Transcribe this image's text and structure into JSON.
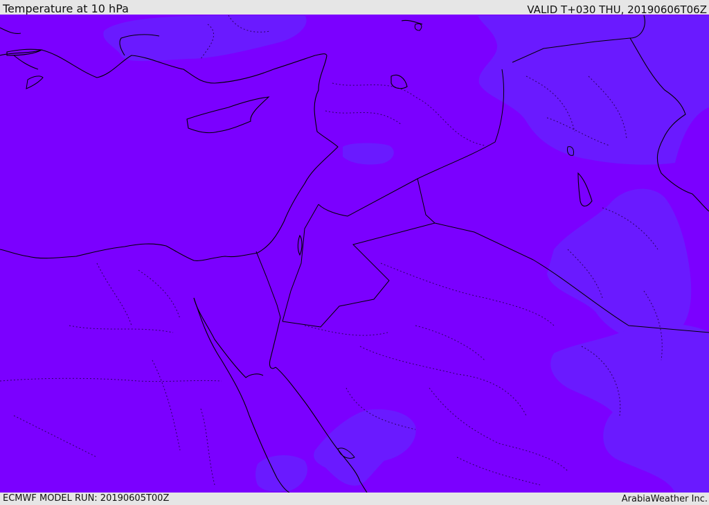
{
  "header": {
    "title": "Temperature at 10 hPa",
    "valid_time": "VALID T+030 THU, 20190606T06Z"
  },
  "footer": {
    "model_run": "ECMWF MODEL RUN: 20190605T00Z",
    "credit": "ArabiaWeather Inc."
  },
  "map": {
    "field_colors": {
      "base": "#7b00ff",
      "cooler": "#6a1aff"
    },
    "coastline_color": "#000000",
    "border_color": "#000000"
  }
}
